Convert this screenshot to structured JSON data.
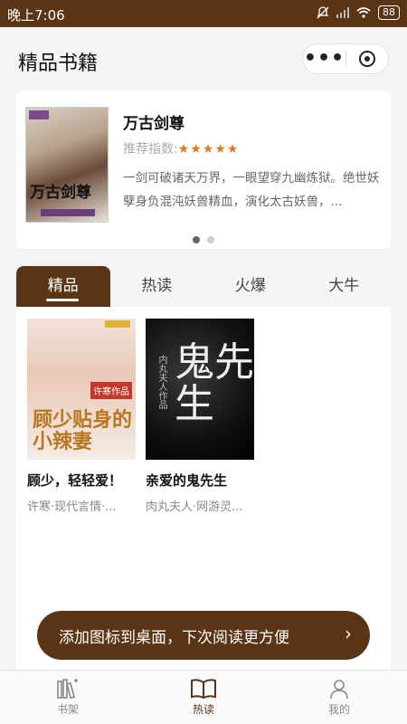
{
  "statusbar": {
    "time": "晚上7:06",
    "battery": "88"
  },
  "navbar": {
    "title": "精品书籍",
    "more_icon": "more-dots-icon",
    "close_icon": "close-circle-icon"
  },
  "featured": {
    "title": "万古剑尊",
    "rating_label": "推荐指数:",
    "stars": "★★★★★",
    "description": "一剑可破诸天万界，一眼望穿九幽炼狱。绝世妖孽身负混沌妖兽精血，演化太古妖兽，...",
    "cover_text": "万古剑尊",
    "carousel_index": 1,
    "carousel_count": 2
  },
  "tabs": [
    {
      "label": "精品",
      "active": true
    },
    {
      "label": "热读",
      "active": false
    },
    {
      "label": "火爆",
      "active": false
    },
    {
      "label": "大牛",
      "active": false
    }
  ],
  "books": [
    {
      "title": "顾少，轻轻爱！",
      "meta": "许寒·现代言情·...",
      "cover_text": "顾少贴身的小辣妻",
      "cover_tag": "许寒作品"
    },
    {
      "title": "亲爱的鬼先生",
      "meta": "肉丸夫人·网游灵...",
      "cover_text": "鬼先生",
      "cover_sub": "内丸夫人作品"
    }
  ],
  "banner": {
    "text": "添加图标到桌面，下次阅读更方便",
    "arrow": "›"
  },
  "tabbar": [
    {
      "label": "书架",
      "icon": "bookshelf-icon",
      "active": false
    },
    {
      "label": "热读",
      "icon": "open-book-icon",
      "active": true
    },
    {
      "label": "我的",
      "icon": "user-icon",
      "active": false
    }
  ],
  "colors": {
    "brand": "#5a3515",
    "star": "#e07c1a"
  }
}
